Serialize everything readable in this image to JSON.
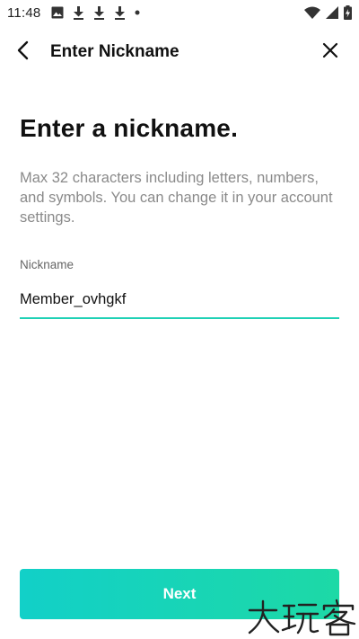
{
  "status_bar": {
    "time": "11:48",
    "icons": [
      "image-icon",
      "download-icon",
      "download-icon",
      "download-icon",
      "dot-icon",
      "wifi-icon",
      "signal-icon",
      "battery-icon"
    ]
  },
  "app_bar": {
    "title": "Enter Nickname",
    "back_icon": "back-arrow-icon",
    "close_icon": "close-icon"
  },
  "main": {
    "heading": "Enter a nickname.",
    "description": "Max 32 characters including letters, numbers, and symbols. You can change it in your account settings.",
    "nickname_label": "Nickname",
    "nickname_value": "Member_ovhgkf",
    "next_label": "Next"
  },
  "watermark": {
    "text": "大玩客"
  },
  "colors": {
    "accent": "#1fd1b5",
    "button_gradient_start": "#12d0c8",
    "button_gradient_end": "#1dd9a6",
    "description_text": "#8a8a8a"
  }
}
